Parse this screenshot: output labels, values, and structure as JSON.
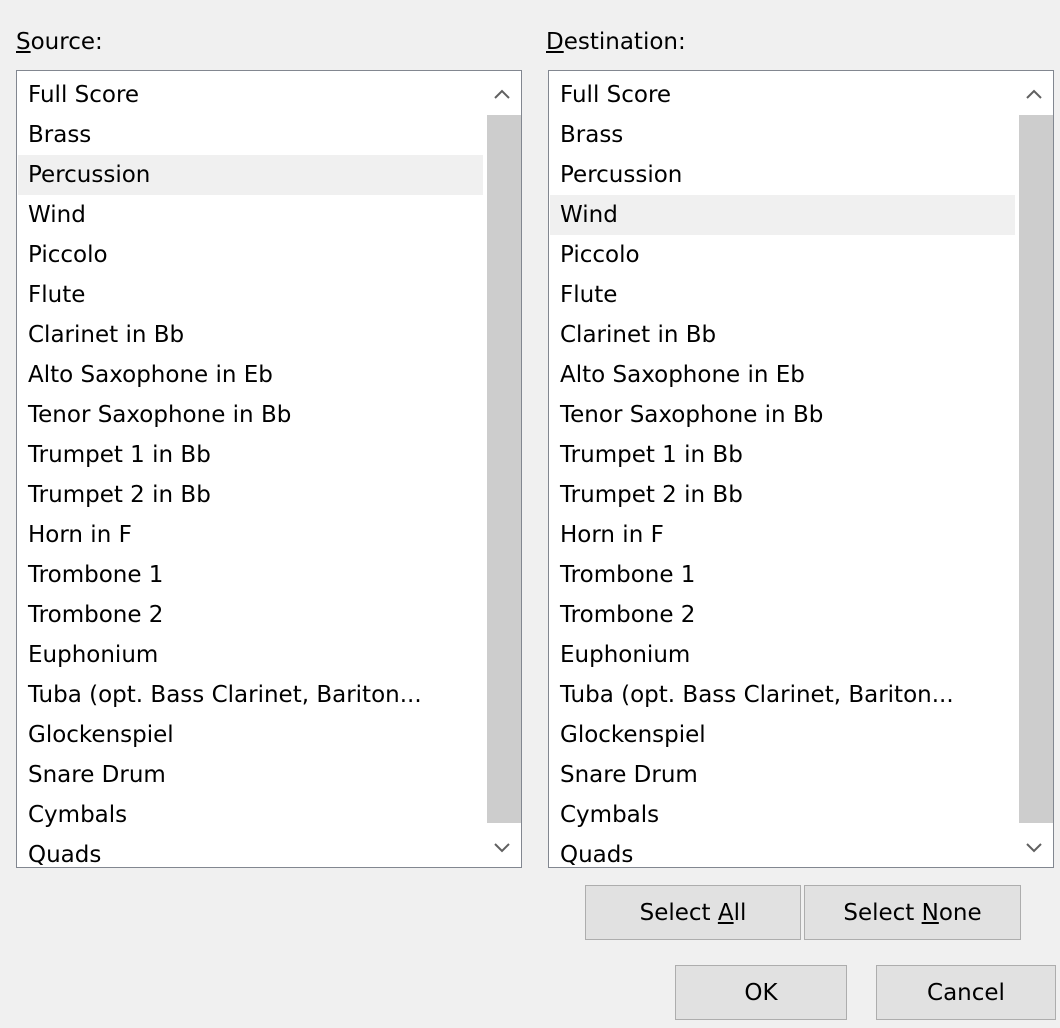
{
  "source": {
    "label_mnemonic": "S",
    "label_rest": "ource:",
    "items": [
      "Full Score",
      "Brass",
      "Percussion",
      "Wind",
      "Piccolo",
      "Flute",
      "Clarinet in Bb",
      "Alto Saxophone in Eb",
      "Tenor Saxophone in Bb",
      "Trumpet 1 in Bb",
      "Trumpet 2 in Bb",
      "Horn in F",
      "Trombone 1",
      "Trombone 2",
      "Euphonium",
      "Tuba (opt. Bass Clarinet, Bariton...",
      "Glockenspiel",
      "Snare Drum",
      "Cymbals",
      "Quads"
    ],
    "selected_item": "Percussion"
  },
  "destination": {
    "label_mnemonic": "D",
    "label_rest": "estination:",
    "items": [
      "Full Score",
      "Brass",
      "Percussion",
      "Wind",
      "Piccolo",
      "Flute",
      "Clarinet in Bb",
      "Alto Saxophone in Eb",
      "Tenor Saxophone in Bb",
      "Trumpet 1 in Bb",
      "Trumpet 2 in Bb",
      "Horn in F",
      "Trombone 1",
      "Trombone 2",
      "Euphonium",
      "Tuba (opt. Bass Clarinet, Bariton...",
      "Glockenspiel",
      "Snare Drum",
      "Cymbals",
      "Quads"
    ],
    "selected_item": "Wind"
  },
  "buttons": {
    "select_all_prefix": "Select ",
    "select_all_mnemonic": "A",
    "select_all_suffix": "ll",
    "select_none_prefix": "Select ",
    "select_none_mnemonic": "N",
    "select_none_suffix": "one",
    "ok": "OK",
    "cancel": "Cancel"
  },
  "icons": {
    "scroll_up": "chevron-up-icon",
    "scroll_down": "chevron-down-icon"
  },
  "colors": {
    "selection_background": "#f0f0f0",
    "scroll_thumb": "#cdcdcd",
    "button_face": "#e1e1e1"
  }
}
